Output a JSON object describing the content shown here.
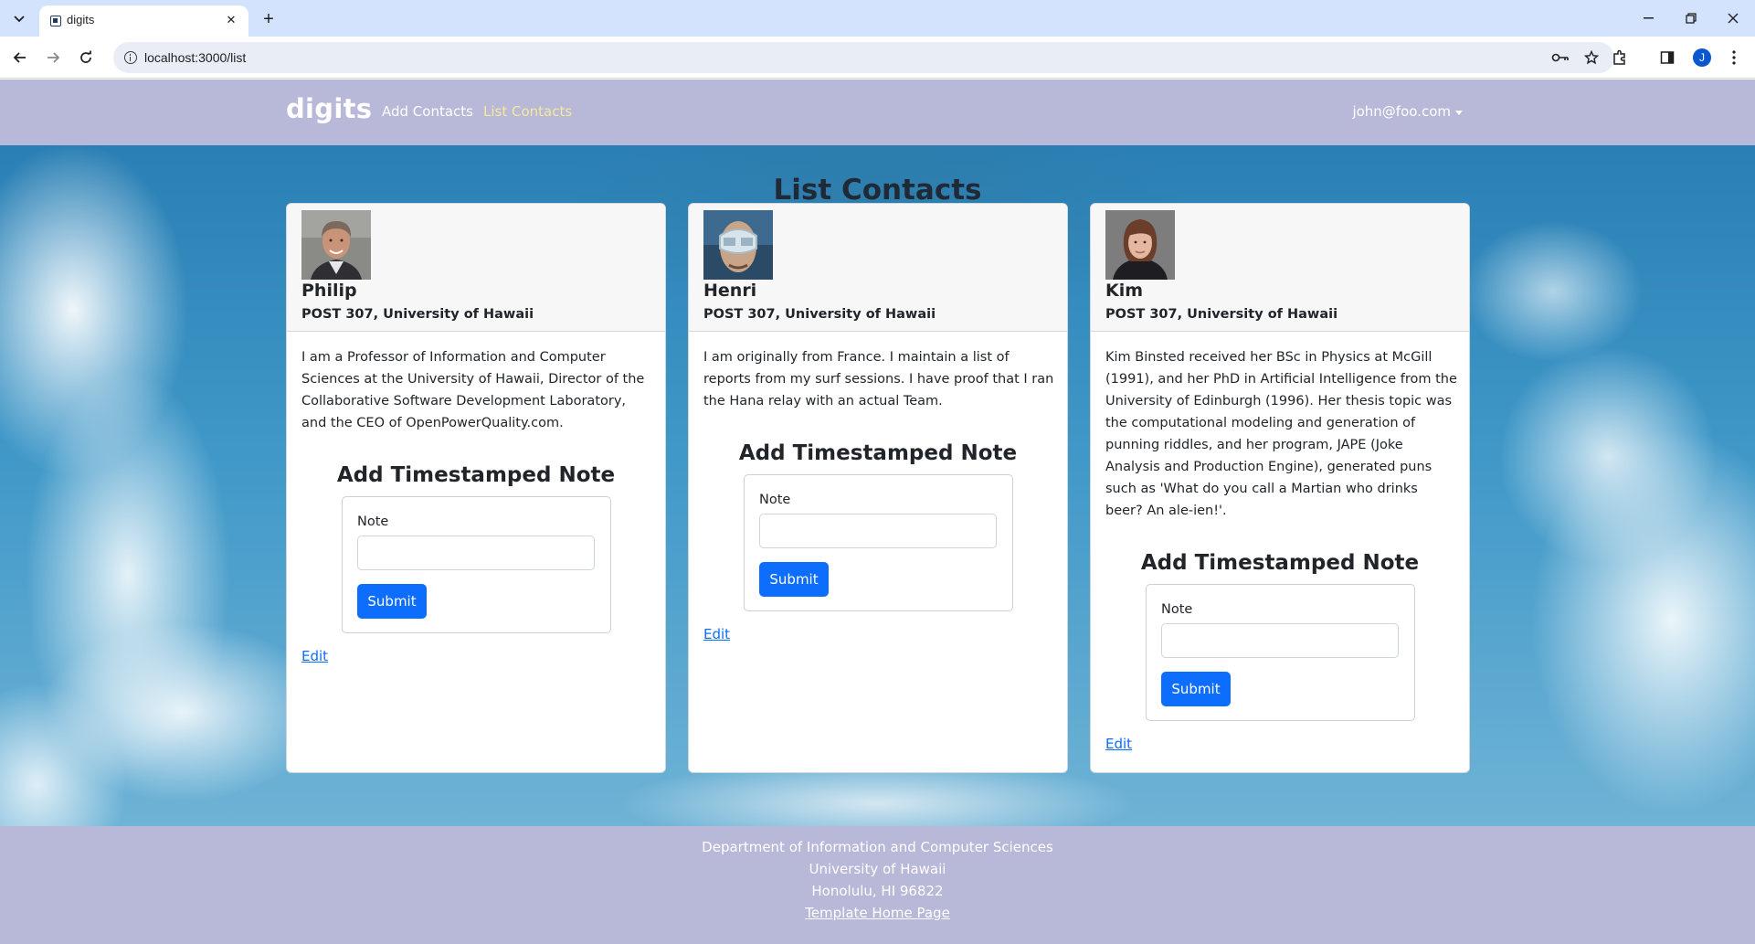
{
  "browser": {
    "tab_title": "digits",
    "url": "localhost:3000/list",
    "profile_initial": "J"
  },
  "navbar": {
    "brand": "digits",
    "links": [
      {
        "label": "Add Contacts",
        "active": false
      },
      {
        "label": "List Contacts",
        "active": true
      }
    ],
    "user": "john@foo.com"
  },
  "page": {
    "title": "List Contacts"
  },
  "contacts": [
    {
      "name": "Philip",
      "address": "POST 307, University of Hawaii",
      "description": "I am a Professor of Information and Computer Sciences at the University of Hawaii, Director of the Collaborative Software Development Laboratory, and the CEO of OpenPowerQuality.com.",
      "note_heading": "Add Timestamped Note",
      "note_label": "Note",
      "note_value": "",
      "submit_label": "Submit",
      "edit_label": "Edit"
    },
    {
      "name": "Henri",
      "address": "POST 307, University of Hawaii",
      "description": "I am originally from France. I maintain a list of reports from my surf sessions. I have proof that I ran the Hana relay with an actual Team.",
      "note_heading": "Add Timestamped Note",
      "note_label": "Note",
      "note_value": "",
      "submit_label": "Submit",
      "edit_label": "Edit"
    },
    {
      "name": "Kim",
      "address": "POST 307, University of Hawaii",
      "description": "Kim Binsted received her BSc in Physics at McGill (1991), and her PhD in Artificial Intelligence from the University of Edinburgh (1996). Her thesis topic was the computational modeling and generation of punning riddles, and her program, JAPE (Joke Analysis and Production Engine), generated puns such as 'What do you call a Martian who drinks beer? An ale-ien!'.",
      "note_heading": "Add Timestamped Note",
      "note_label": "Note",
      "note_value": "",
      "submit_label": "Submit",
      "edit_label": "Edit"
    }
  ],
  "footer": {
    "line1": "Department of Information and Computer Sciences",
    "line2": "University of Hawaii",
    "line3": "Honolulu, HI 96822",
    "link": "Template Home Page"
  },
  "colors": {
    "navbar_bg": "#b8b8d8",
    "active_link": "#f6e99c",
    "primary": "#0d6efd"
  }
}
